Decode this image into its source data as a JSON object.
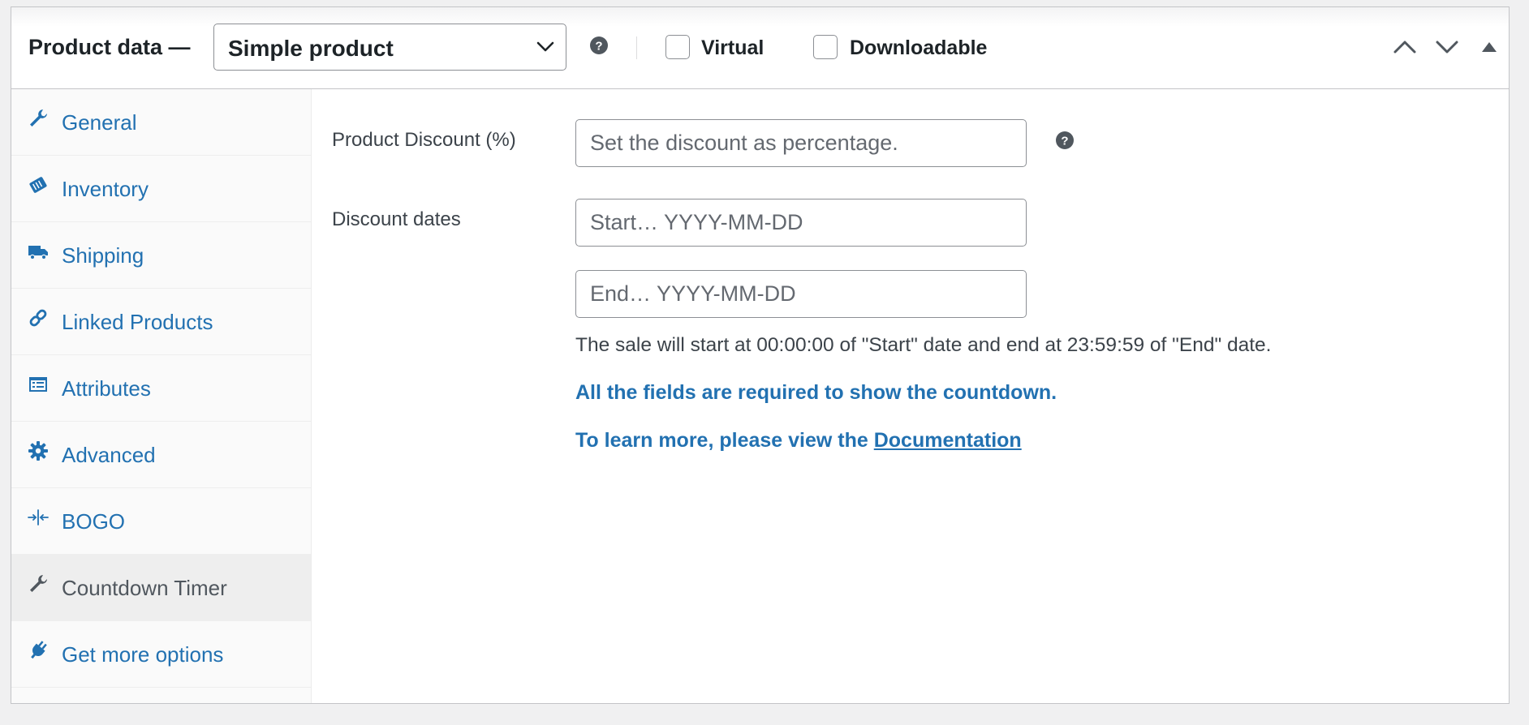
{
  "header": {
    "title": "Product data —",
    "product_type": {
      "selected": "Simple product",
      "options": [
        "Simple product"
      ]
    },
    "checkboxes": {
      "virtual": {
        "label": "Virtual",
        "checked": false
      },
      "downloadable": {
        "label": "Downloadable",
        "checked": false
      }
    },
    "icons": {
      "help": "question-circle-icon",
      "move_up": "chevron-up-icon",
      "move_down": "chevron-down-icon",
      "toggle": "triangle-up-icon"
    }
  },
  "sidebar": {
    "items": [
      {
        "label": "General",
        "icon": "wrench-icon",
        "active": false
      },
      {
        "label": "Inventory",
        "icon": "tag-icon",
        "active": false
      },
      {
        "label": "Shipping",
        "icon": "truck-icon",
        "active": false
      },
      {
        "label": "Linked Products",
        "icon": "link-icon",
        "active": false
      },
      {
        "label": "Attributes",
        "icon": "list-card-icon",
        "active": false
      },
      {
        "label": "Advanced",
        "icon": "gear-icon",
        "active": false
      },
      {
        "label": "BOGO",
        "icon": "split-arrows-icon",
        "active": false
      },
      {
        "label": "Countdown Timer",
        "icon": "wrench-icon",
        "active": true
      },
      {
        "label": "Get more options",
        "icon": "plug-icon",
        "active": false
      }
    ]
  },
  "main": {
    "discount": {
      "label": "Product Discount (%)",
      "value": "",
      "placeholder": "Set the discount as percentage."
    },
    "dates": {
      "label": "Discount dates",
      "start_placeholder": "Start… YYYY-MM-DD",
      "end_placeholder": "End… YYYY-MM-DD",
      "start_value": "",
      "end_value": ""
    },
    "note": "The sale will start at 00:00:00 of \"Start\" date and end at 23:59:59 of \"End\" date.",
    "required_notice": "All the fields are required to show the countdown.",
    "learn_more_prefix": "To learn more, please view the ",
    "learn_more_link": "Documentation"
  },
  "colors": {
    "link": "#2271b1",
    "text": "#1d2327",
    "muted_text": "#3c434a",
    "border": "#8c8f94",
    "active_tab_bg": "#eeeeee",
    "sidebar_bg": "#fafafa",
    "page_bg": "#f0f0f1"
  }
}
